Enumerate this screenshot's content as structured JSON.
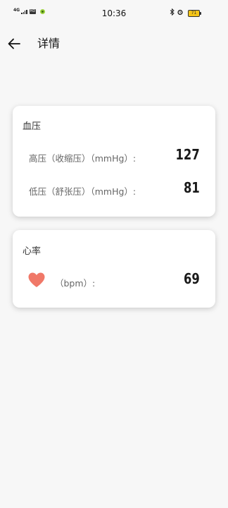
{
  "status_bar": {
    "network": "4G",
    "hd": "HD",
    "time": "10:36",
    "battery": "71",
    "icons": [
      "signal-icon",
      "hd-icon",
      "app-notification-icon",
      "bluetooth-icon",
      "alarm-icon",
      "battery-icon"
    ]
  },
  "header": {
    "back_icon": "arrow-left-icon",
    "title": "详情"
  },
  "blood_pressure": {
    "title": "血压",
    "systolic_label": "高压（收缩压）（mmHg）:",
    "systolic_value": "127",
    "diastolic_label": "低压（舒张压）（mmHg）:",
    "diastolic_value": "81"
  },
  "heart_rate": {
    "title": "心率",
    "icon": "heart-icon",
    "icon_color": "#f07868",
    "label": "（bpm）:",
    "value": "69"
  }
}
